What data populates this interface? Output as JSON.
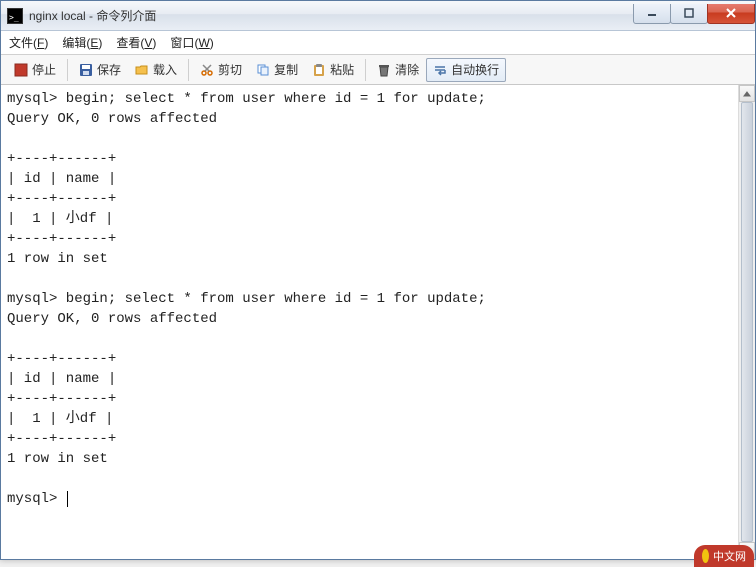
{
  "window": {
    "title": "nginx local - 命令列介面"
  },
  "menubar": {
    "file": {
      "label": "文件",
      "mnemonic": "F"
    },
    "edit": {
      "label": "编辑",
      "mnemonic": "E"
    },
    "view": {
      "label": "查看",
      "mnemonic": "V"
    },
    "window": {
      "label": "窗口",
      "mnemonic": "W"
    }
  },
  "toolbar": {
    "stop": "停止",
    "save": "保存",
    "load": "载入",
    "cut": "剪切",
    "copy": "复制",
    "paste": "粘贴",
    "clear": "清除",
    "wrap": "自动换行"
  },
  "terminal": {
    "lines": [
      "mysql> begin; select * from user where id = 1 for update;",
      "Query OK, 0 rows affected",
      "",
      "+----+------+",
      "| id | name |",
      "+----+------+",
      "|  1 | 小df |",
      "+----+------+",
      "1 row in set",
      "",
      "mysql> begin; select * from user where id = 1 for update;",
      "Query OK, 0 rows affected",
      "",
      "+----+------+",
      "| id | name |",
      "+----+------+",
      "|  1 | 小df |",
      "+----+------+",
      "1 row in set",
      "",
      "mysql> "
    ]
  },
  "badge": {
    "text": "中文网"
  }
}
